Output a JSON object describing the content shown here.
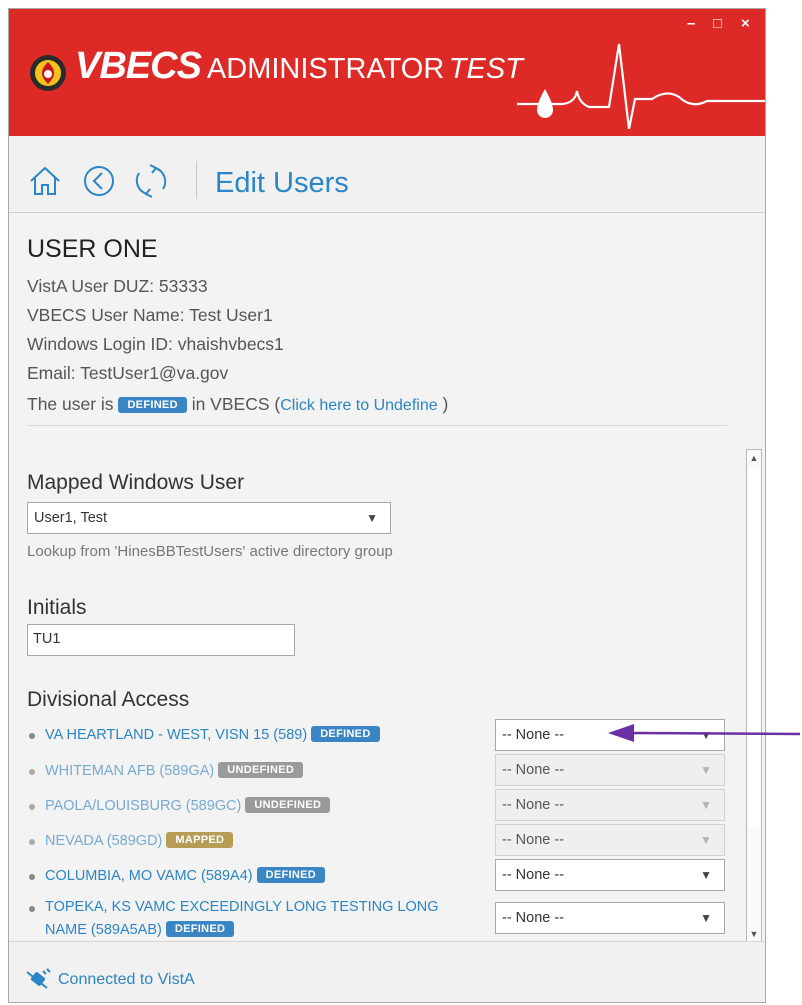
{
  "app": {
    "brand_main": "VBECS",
    "brand_sub": "ADMINISTRATOR",
    "brand_env": "TEST",
    "window_controls": {
      "minimize": "–",
      "maximize": "□",
      "close": "×"
    }
  },
  "toolbar": {
    "title": "Edit Users",
    "icons": [
      "home-icon",
      "back-icon",
      "refresh-icon"
    ]
  },
  "user": {
    "name": "USER ONE",
    "duz": "VistA User DUZ: 53333",
    "vbecs_name": "VBECS User Name: Test User1",
    "login": "Windows Login ID: vhaishvbecs1",
    "email": "Email: TestUser1@va.gov",
    "status_prefix": "The user is",
    "status_badge": "DEFINED",
    "status_middle": "in VBECS (",
    "status_link": "Click here to Undefine",
    "status_suffix": ")"
  },
  "mapped_user": {
    "label": "Mapped Windows User",
    "value": "User1, Test",
    "lookup": "Lookup from 'HinesBBTestUsers' active directory group"
  },
  "initials": {
    "label": "Initials",
    "value": "TU1"
  },
  "divisional": {
    "label": "Divisional Access",
    "rows": [
      {
        "name": "VA HEARTLAND - WEST, VISN 15 (589)",
        "badge": "DEFINED",
        "badge_type": "defined",
        "select": "-- None --",
        "enabled": true
      },
      {
        "name": "WHITEMAN AFB (589GA)",
        "badge": "UNDEFINED",
        "badge_type": "undefined",
        "select": "-- None --",
        "enabled": false
      },
      {
        "name": "PAOLA/LOUISBURG (589GC)",
        "badge": "UNDEFINED",
        "badge_type": "undefined",
        "select": "-- None --",
        "enabled": false
      },
      {
        "name": "NEVADA (589GD)",
        "badge": "MAPPED",
        "badge_type": "mapped",
        "select": "-- None --",
        "enabled": false
      },
      {
        "name": "COLUMBIA, MO VAMC (589A4)",
        "badge": "DEFINED",
        "badge_type": "defined",
        "select": "-- None --",
        "enabled": true
      },
      {
        "name_line1": "TOPEKA, KS VAMC EXCEEDINGLY LONG TESTING LONG",
        "name_line2": "NAME (589A5AB)",
        "badge": "DEFINED",
        "badge_type": "defined",
        "select": "-- None --",
        "enabled": true
      }
    ]
  },
  "status": {
    "text": "Connected to VistA"
  },
  "colors": {
    "titlebar": "#de2a26",
    "accent": "#2b85c6",
    "annotation_arrow": "#6b2fa5"
  }
}
